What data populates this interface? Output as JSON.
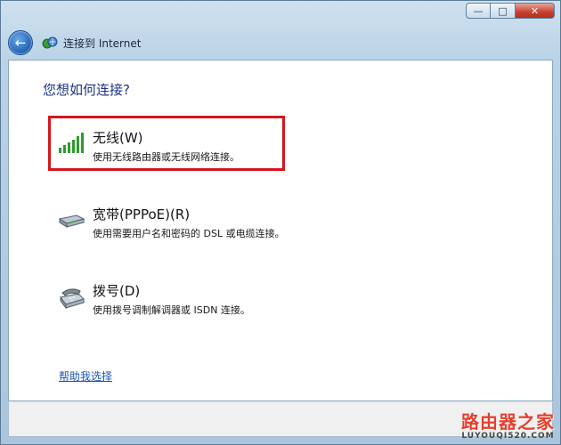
{
  "window": {
    "title": "连接到 Internet",
    "controls": {
      "minimize": "—",
      "maximize": "□",
      "close": "✕"
    }
  },
  "page": {
    "heading": "您想如何连接?",
    "options": [
      {
        "title": "无线(W)",
        "description": "使用无线路由器或无线网络连接。",
        "icon": "wireless-signal-icon"
      },
      {
        "title": "宽带(PPPoE)(R)",
        "description": "使用需要用户名和密码的 DSL 或电缆连接。",
        "icon": "broadband-modem-icon"
      },
      {
        "title": "拨号(D)",
        "description": "使用拨号调制解调器或 ISDN 连接。",
        "icon": "dialup-phone-icon"
      }
    ],
    "help_link": "帮助我选择"
  },
  "watermark": {
    "cn": "路由器之家",
    "en": "LUYOUQI520.COM"
  },
  "colors": {
    "heading": "#1e3287",
    "highlight": "#d4161c",
    "link": "#1a55b4"
  }
}
